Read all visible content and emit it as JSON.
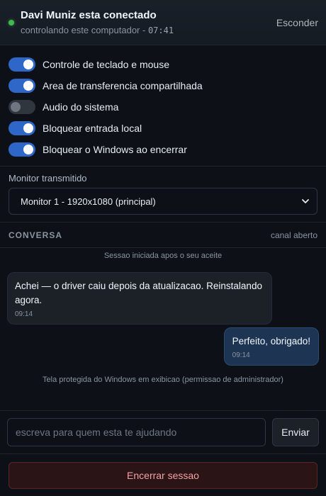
{
  "header": {
    "title": "Davi Muniz esta conectado",
    "subtitle": "controlando este computador - ",
    "timer": "07:41",
    "hide_label": "Esconder"
  },
  "toggles": [
    {
      "label": "Controle de teclado e mouse",
      "on": true
    },
    {
      "label": "Area de transferencia compartilhada",
      "on": true
    },
    {
      "label": "Audio do sistema",
      "on": false
    },
    {
      "label": "Bloquear entrada local",
      "on": true
    },
    {
      "label": "Bloquear o Windows ao encerrar",
      "on": true
    }
  ],
  "monitor": {
    "label": "Monitor transmitido",
    "selected": "Monitor 1 - 1920x1080 (principal)"
  },
  "chat": {
    "title": "CONVERSA",
    "state": "canal aberto",
    "messages": [
      {
        "type": "system",
        "text": "Sessao iniciada apos o seu aceite"
      },
      {
        "type": "incoming",
        "text": "Achei — o driver caiu depois da atualizacao. Reinstalando agora.",
        "time": "09:14"
      },
      {
        "type": "outgoing",
        "text": "Perfeito, obrigado!",
        "time": "09:14"
      },
      {
        "type": "system",
        "text": "Tela protegida do Windows em exibicao (permissao de administrador)"
      }
    ],
    "input_placeholder": "escreva para quem esta te ajudando",
    "input_value": "",
    "send_label": "Enviar"
  },
  "end_session_label": "Encerrar sessao",
  "colors": {
    "accent": "#2f67c9",
    "status_online": "#3fb950",
    "danger_text": "#f3a1a1",
    "background": "#0d1117"
  }
}
